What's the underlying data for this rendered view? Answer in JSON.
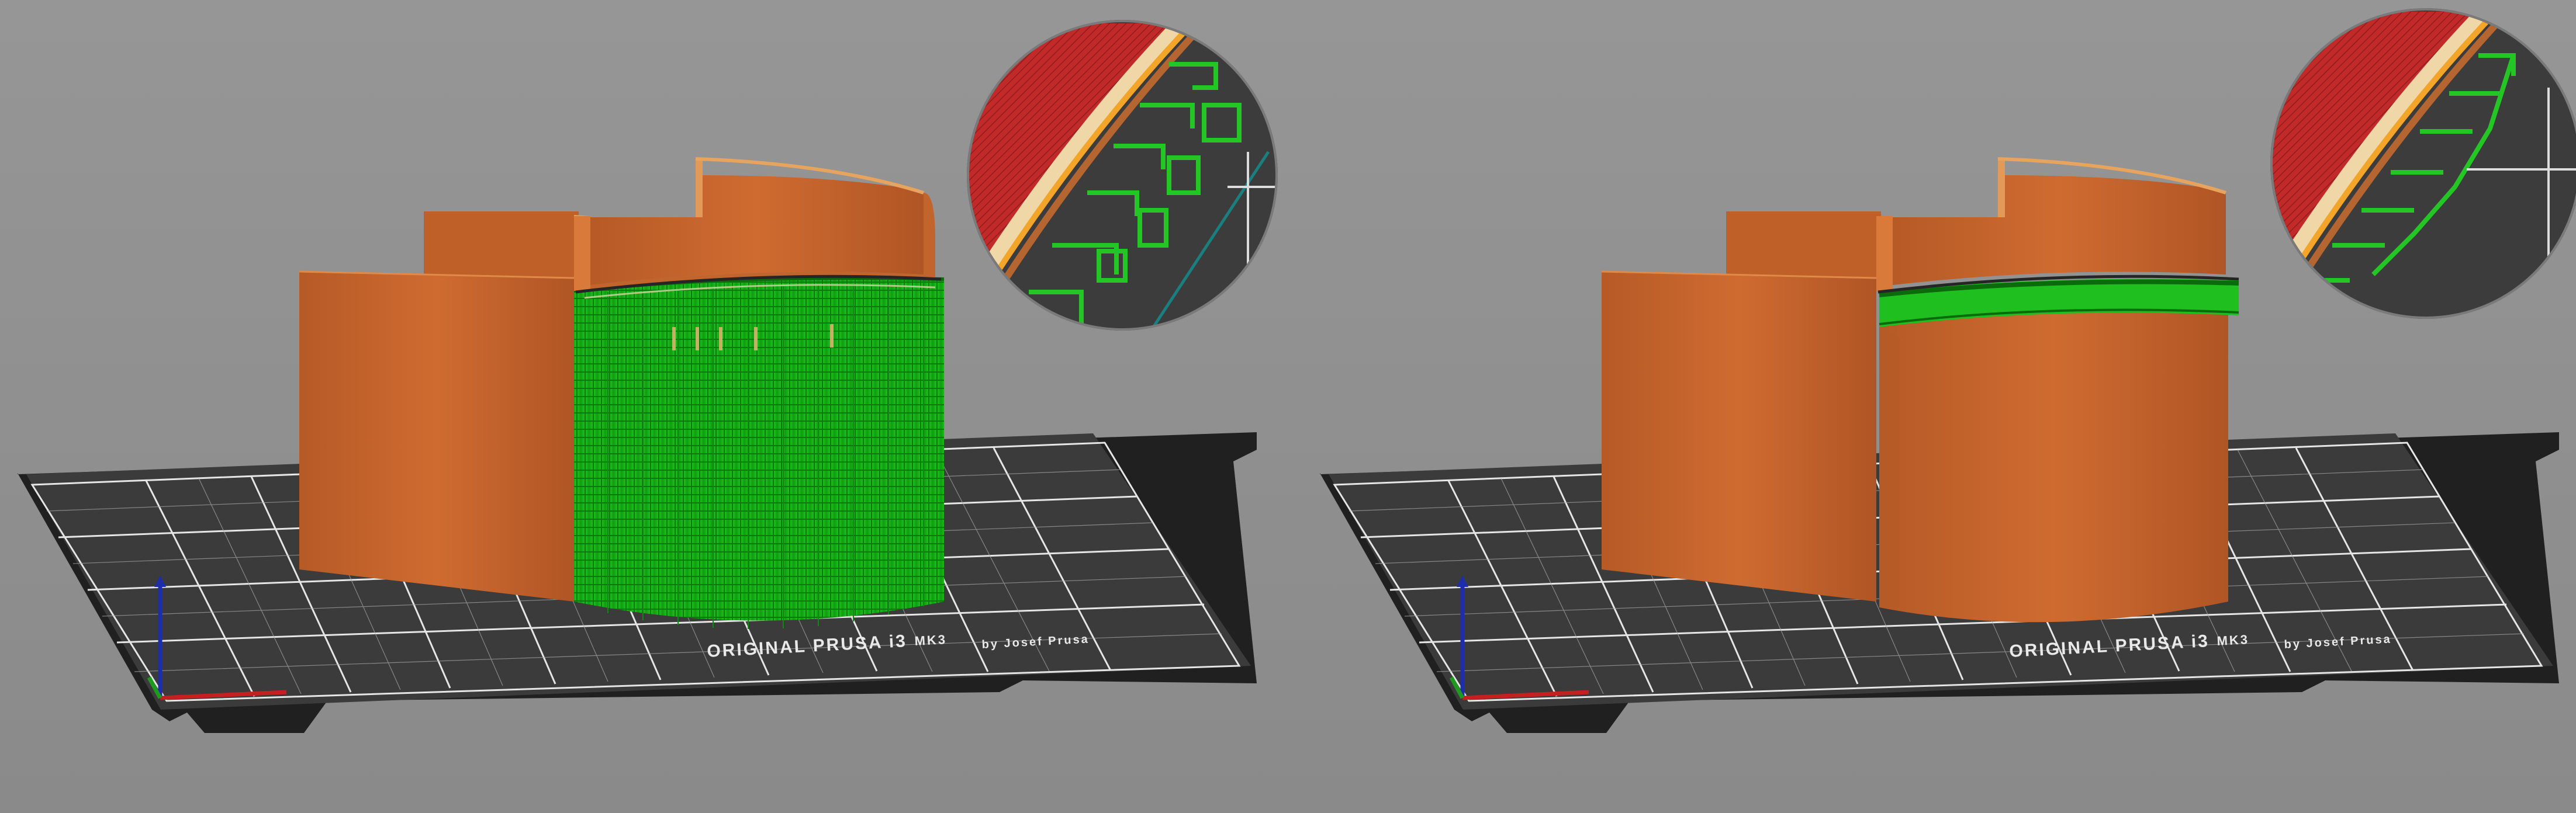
{
  "views": [
    {
      "id": "left",
      "description_key": "support-full",
      "bed": {
        "brand_line": "ORIGINAL PRUSA i3",
        "model": "MK3",
        "byline": "by Josef Prusa"
      }
    },
    {
      "id": "right",
      "description_key": "support-minimal",
      "bed": {
        "brand_line": "ORIGINAL PRUSA i3",
        "model": "MK3",
        "byline": "by Josef Prusa"
      }
    }
  ],
  "colors": {
    "background": "#8f8f8f",
    "bed": "#3a3a3b",
    "bed_edge": "#1f1f20",
    "grid": "#e6e6e6",
    "model_orange": "#c0622b",
    "model_orange_dark": "#a24f20",
    "support_green": "#16b317",
    "support_green_dark": "#0f7d10",
    "top_red": "#c02a2a",
    "axis_z": "#1e2ea8",
    "axis_x": "#c42020",
    "axis_y": "#1f9a1f"
  },
  "icons": [
    "z-axis-arrow-icon",
    "x-axis-icon",
    "y-axis-icon",
    "zoom-circle-icon"
  ]
}
